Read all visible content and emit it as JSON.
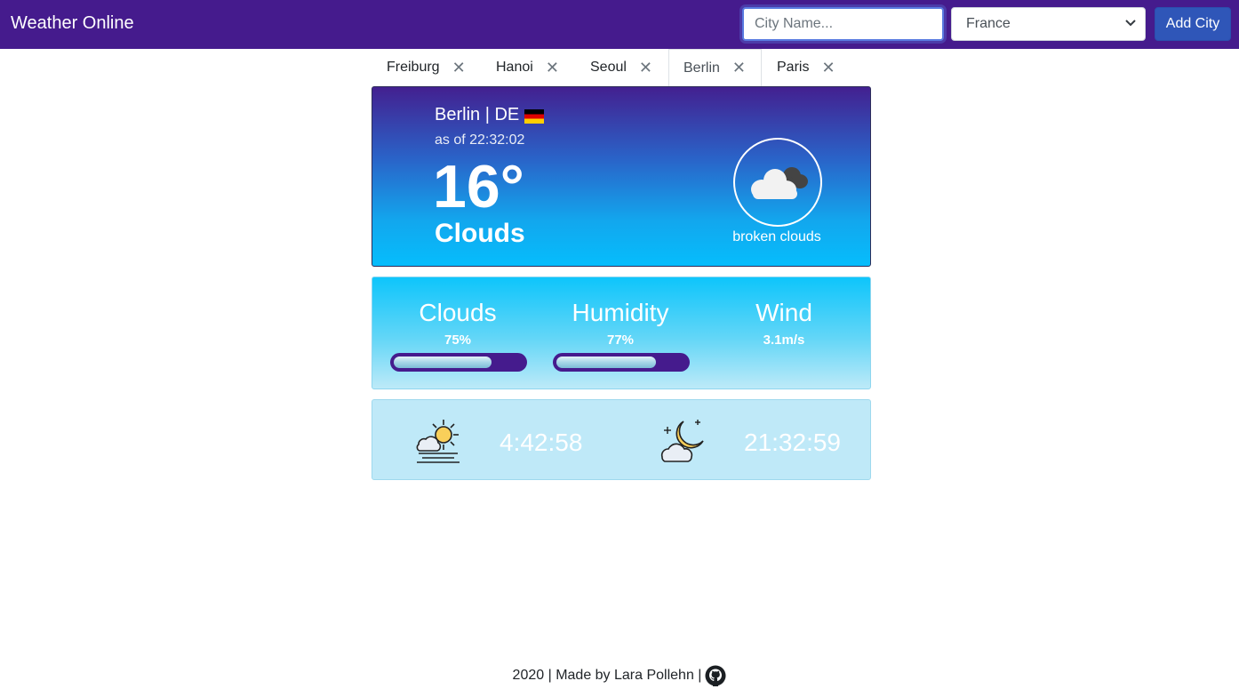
{
  "navbar": {
    "brand": "Weather Online",
    "city_input": {
      "placeholder": "City Name...",
      "value": ""
    },
    "country_select": {
      "selected": "France"
    },
    "add_button_label": "Add City"
  },
  "tabs": [
    {
      "label": "Freiburg",
      "close": "✕",
      "active": false
    },
    {
      "label": "Hanoi",
      "close": "✕",
      "active": false
    },
    {
      "label": "Seoul",
      "close": "✕",
      "active": false
    },
    {
      "label": "Berlin",
      "close": "✕",
      "active": true
    },
    {
      "label": "Paris",
      "close": "✕",
      "active": false
    }
  ],
  "current": {
    "city": "Berlin | DE",
    "flag_icon": "germany-flag-icon",
    "as_of": "as of 22:32:02",
    "temperature": "16°",
    "condition": "Clouds",
    "icon": "broken-clouds-icon",
    "description": "broken clouds"
  },
  "stats": {
    "clouds": {
      "label": "Clouds",
      "value": "75%",
      "fraction": 0.75
    },
    "humidity": {
      "label": "Humidity",
      "value": "77%",
      "fraction": 0.77
    },
    "wind": {
      "label": "Wind",
      "value": "3.1m/s"
    }
  },
  "sun": {
    "sunrise_icon": "sunrise-icon",
    "sunrise": "4:42:58",
    "sunset_icon": "moon-night-icon",
    "sunset": "21:32:59"
  },
  "footer": {
    "text": "2020 | Made by Lara Pollehn |",
    "icon": "github-icon"
  },
  "colors": {
    "navbar": "#451b8d",
    "button": "#2f56b8",
    "progress_track": "#451b8d"
  }
}
